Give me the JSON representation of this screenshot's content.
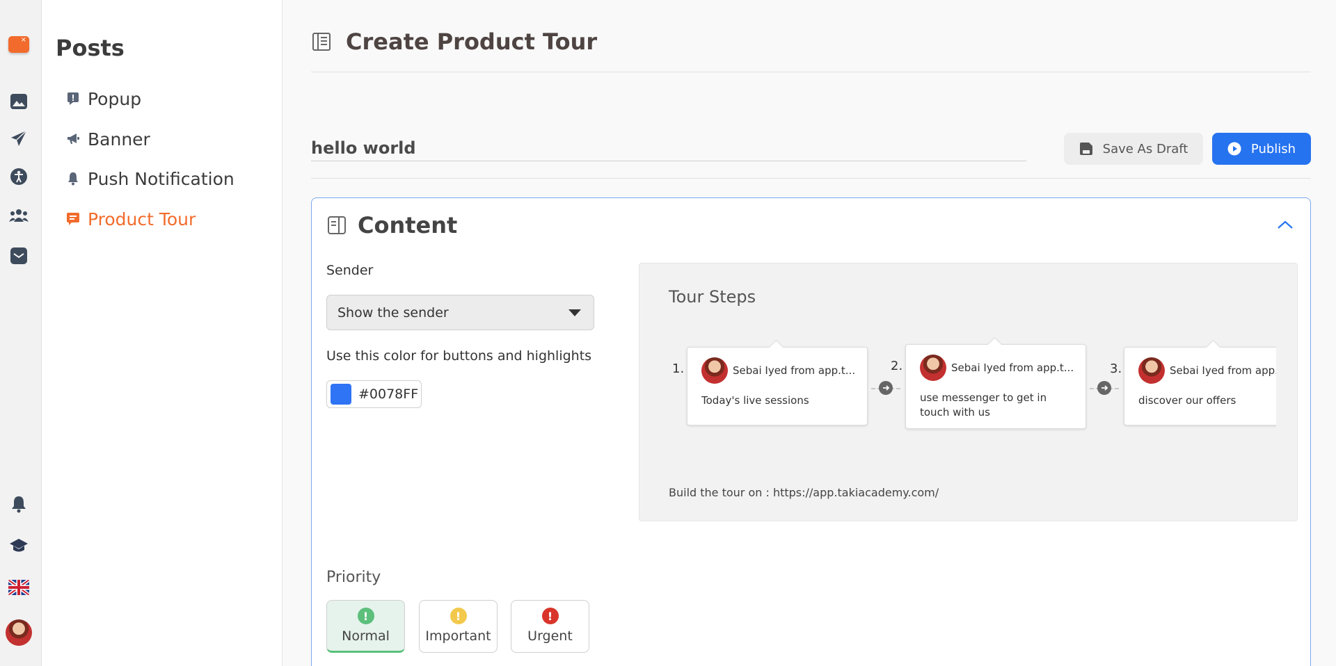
{
  "rail": {
    "items": [
      "image-icon",
      "send-icon",
      "accessibility-icon",
      "users-icon",
      "inbox-icon"
    ],
    "bottom": [
      "bell-icon",
      "graduation-cap-icon",
      "uk-flag-icon",
      "avatar"
    ]
  },
  "subnav": {
    "title": "Posts",
    "items": [
      {
        "label": "Popup",
        "icon": "alert-icon"
      },
      {
        "label": "Banner",
        "icon": "megaphone-icon"
      },
      {
        "label": "Push Notification",
        "icon": "bell-icon"
      },
      {
        "label": "Product Tour",
        "icon": "chat-icon",
        "active": true
      }
    ]
  },
  "header": {
    "title": "Create Product Tour"
  },
  "post": {
    "name": "hello world"
  },
  "actions": {
    "save_draft": "Save As Draft",
    "publish": "Publish"
  },
  "content": {
    "title": "Content",
    "sender_label": "Sender",
    "sender_value": "Show the sender",
    "color_label": "Use this color for buttons and highlights",
    "color_value": "#0078FF",
    "color_swatch": "#2f74f5",
    "tour": {
      "title": "Tour Steps",
      "steps": [
        {
          "num": "1.",
          "sender": "Sebai Iyed from app.t...",
          "message": "Today's live sessions"
        },
        {
          "num": "2.",
          "sender": "Sebai Iyed from app.t...",
          "message": "use messenger to get in touch with us"
        },
        {
          "num": "3.",
          "sender": "Sebai Iyed from app.t...",
          "message": "discover our offers"
        }
      ],
      "footer_prefix": "Build the tour on : ",
      "footer_url": "https://app.takiacademy.com/"
    },
    "priority": {
      "label": "Priority",
      "options": [
        {
          "label": "Normal",
          "color": "#5dbf7c",
          "active": true
        },
        {
          "label": "Important",
          "color": "#f2c94c"
        },
        {
          "label": "Urgent",
          "color": "#d9352b"
        }
      ]
    }
  }
}
